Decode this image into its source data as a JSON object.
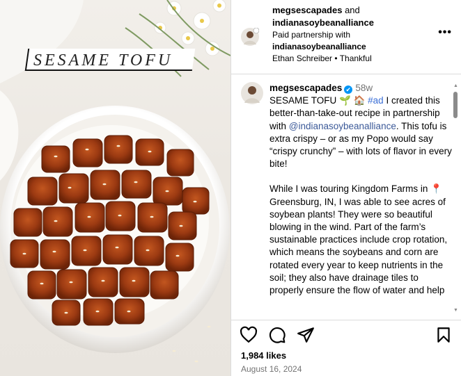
{
  "photo": {
    "title": "SESAME TOFU"
  },
  "header": {
    "author_line1": "megsescapades",
    "and_text": " and",
    "author_line2": "indianasoybeanalliance",
    "partnership_label": "Paid partnership with",
    "partner_name": "indianasoybeanalliance",
    "audio": "Ethan Schreiber • Thankful",
    "more": "•••"
  },
  "caption": {
    "username": "megsescapades",
    "verified_icon": "✔",
    "time": "58w",
    "intro": "SESAME TOFU 🌱 🏠 ",
    "hashtag": "#ad",
    "text1": " I created this better-than-take-out recipe in partnership with ",
    "mention": "@indianasoybeanalliance",
    "text2": ".  This tofu is extra crispy – or as my Popo would say “crispy crunchy” – with lots of flavor in every bite!",
    "para2_pin": "📍",
    "para2": "While I was touring Kingdom Farms in  Greensburg, IN, I was able to see acres of soybean plants!  They were so beautiful blowing in the wind.  Part of the farm’s sustainable practices include crop rotation, which means the soybeans and corn are rotated every year to keep nutrients in the soil; they also have drainage tiles to properly ensure the flow of water and help"
  },
  "scroll": {
    "up": "▲",
    "down": "▼"
  },
  "footer": {
    "likes": "1,984 likes",
    "date": "August 16, 2024"
  },
  "colors": {
    "link": "#3b5998",
    "hashtag": "#3b6fd6",
    "verified": "#0095f6",
    "muted": "#737373"
  }
}
